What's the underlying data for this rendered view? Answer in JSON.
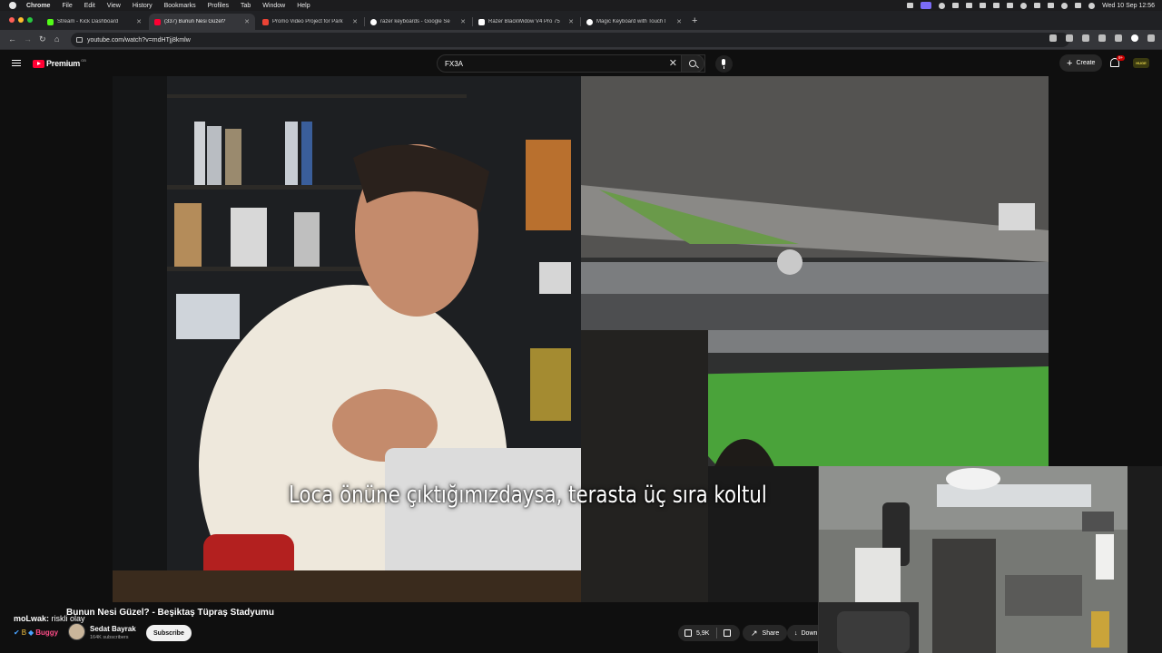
{
  "menubar": {
    "app": "Chrome",
    "items": [
      "File",
      "Edit",
      "View",
      "History",
      "Bookmarks",
      "Profiles",
      "Tab",
      "Window",
      "Help"
    ],
    "clock": "Wed 10 Sep  12:56"
  },
  "tabs": [
    {
      "title": "Stream - Kick Dashboard",
      "favicon_color": "#53fc18"
    },
    {
      "title": "(337) Bunun Nesi Güzel?",
      "favicon_color": "#ff0033"
    },
    {
      "title": "Promo Video Project for Park",
      "favicon_color": "#ea4335"
    },
    {
      "title": "razer keyboards - Google Se",
      "favicon_color": "#ffffff"
    },
    {
      "title": "Razer BlackWidow V4 Pro 75",
      "favicon_color": "#ffffff"
    },
    {
      "title": "Magic Keyboard with Touch I",
      "favicon_color": "#ffffff"
    }
  ],
  "address": {
    "url": "youtube.com/watch?v=mdHTjj8kmlw"
  },
  "youtube": {
    "logo_text": "Premium",
    "logo_country": "GB",
    "search_value": "FX3A",
    "create_label": "Create",
    "notif_count": "9+",
    "account_text": "HUGE"
  },
  "video": {
    "subtitle": "Loca önüne çıktığımızdaysa, terasta üç sıra koltul",
    "title": "Bunun Nesi Güzel? - Beşiktaş Tüpraş Stadyumu",
    "channel": "Sedat Bayrak",
    "subscribers": "164K subscribers",
    "subscribe_label": "Subscribe",
    "likes": "5,9K",
    "share_label": "Share",
    "download_label": "Down"
  },
  "chat": {
    "line1_user": "moLwak:",
    "line1_text": "riskli olay",
    "line2_user": "Buggy"
  },
  "colors": {
    "brand": "#ff0033",
    "bg": "#0f0f0f"
  }
}
